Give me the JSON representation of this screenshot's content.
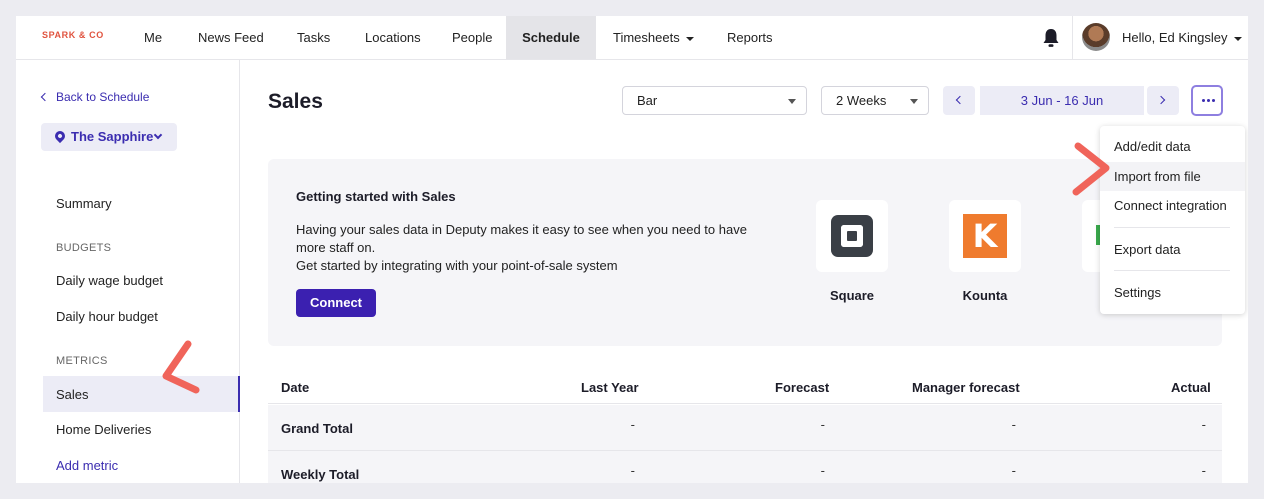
{
  "brand": "SPARK & CO",
  "nav": {
    "items": [
      {
        "label": "Me"
      },
      {
        "label": "News Feed"
      },
      {
        "label": "Tasks"
      },
      {
        "label": "Locations"
      },
      {
        "label": "People"
      },
      {
        "label": "Schedule",
        "active": true
      },
      {
        "label": "Timesheets",
        "dropdown": true
      },
      {
        "label": "Reports"
      }
    ],
    "greeting": "Hello, Ed Kingsley"
  },
  "sidebar": {
    "back_label": "Back to Schedule",
    "location": "The Sapphire",
    "summary": "Summary",
    "budgets_heading": "BUDGETS",
    "budget_items": [
      "Daily wage budget",
      "Daily hour budget"
    ],
    "metrics_heading": "METRICS",
    "metric_items": [
      {
        "label": "Sales",
        "active": true
      },
      {
        "label": "Home Deliveries"
      }
    ],
    "add_metric": "Add metric"
  },
  "main": {
    "title": "Sales",
    "chart_type": "Bar",
    "period": "2 Weeks",
    "date_range": "3 Jun - 16 Jun"
  },
  "getting_started": {
    "title": "Getting started with Sales",
    "lines": [
      "Having your sales data in Deputy makes it easy to see when you need to have",
      "more staff on.",
      "Get started by integrating with your point-of-sale system"
    ],
    "connect_label": "Connect",
    "integrations": [
      {
        "name": "Square",
        "icon": "square-logo-icon"
      },
      {
        "name": "Kounta",
        "icon": "kounta-logo-icon"
      }
    ]
  },
  "table": {
    "columns": [
      "Date",
      "Last Year",
      "Forecast",
      "Manager forecast",
      "Actual"
    ],
    "rows": [
      {
        "label": "Grand Total",
        "values": [
          "-",
          "-",
          "-",
          "-"
        ]
      },
      {
        "label": "Weekly Total",
        "values": [
          "-",
          "-",
          "-",
          "-"
        ]
      }
    ]
  },
  "more_menu": {
    "items": [
      "Add/edit data",
      "Import from file",
      "Connect integration",
      "Export data",
      "Settings"
    ]
  },
  "colors": {
    "accent": "#3b2db0",
    "brand": "#e0533f",
    "callout": "#f0645a"
  }
}
